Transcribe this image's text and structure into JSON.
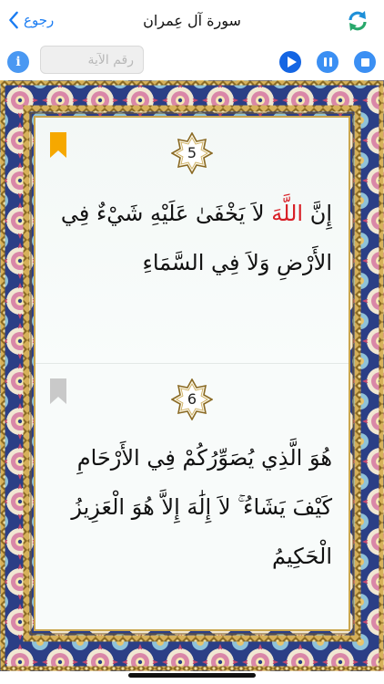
{
  "nav": {
    "back_label": "رجوع",
    "title": "سورة آل عِمران",
    "sync_icon": "sync-arrows-icon",
    "accent_color": "#1a7cf2"
  },
  "toolbar": {
    "verse_input_placeholder": "رقم الآية",
    "verse_input_value": "",
    "info_label": "i",
    "buttons": [
      "play-icon",
      "pause-icon",
      "stop-icon"
    ]
  },
  "verses": [
    {
      "number": "5",
      "bookmarked": true,
      "bookmark_color": "#f6a800",
      "text_allah": "اللَّهَ",
      "text_before": "إِنَّ",
      "text_after": "لاَ يَخْفَىٰ عَلَيْهِ شَيْءٌ فِي الأَرْضِ وَلاَ فِي السَّمَاءِ"
    },
    {
      "number": "6",
      "bookmarked": false,
      "bookmark_color": "#c9c9c9",
      "text": "هُوَ الَّذِي يُصَوِّرُكُمْ فِي الأَرْحَامِ كَيْفَ يَشَاءُ ۚ لاَ إِلَٰهَ إِلاَّ هُوَ الْعَزِيزُ الْحَكِيمُ"
    }
  ]
}
